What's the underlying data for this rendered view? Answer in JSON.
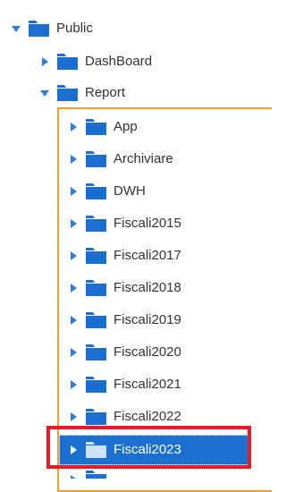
{
  "tree": {
    "root": {
      "label": "Public",
      "expanded": true
    },
    "level1": [
      {
        "label": "DashBoard",
        "expanded": false
      },
      {
        "label": "Report",
        "expanded": true
      }
    ],
    "report_children": [
      {
        "label": "App"
      },
      {
        "label": "Archiviare"
      },
      {
        "label": "DWH"
      },
      {
        "label": "Fiscali2015"
      },
      {
        "label": "Fiscali2017"
      },
      {
        "label": "Fiscali2018"
      },
      {
        "label": "Fiscali2019"
      },
      {
        "label": "Fiscali2020"
      },
      {
        "label": "Fiscali2021"
      },
      {
        "label": "Fiscali2022"
      },
      {
        "label": "Fiscali2023",
        "selected": true
      }
    ]
  },
  "colors": {
    "folder_blue": "#1b6fd1",
    "arrow_blue": "#2d7fe0",
    "selection_blue": "#1b6fd1",
    "group_outline": "#f2a12c",
    "annotation_red": "#e51c2a"
  }
}
